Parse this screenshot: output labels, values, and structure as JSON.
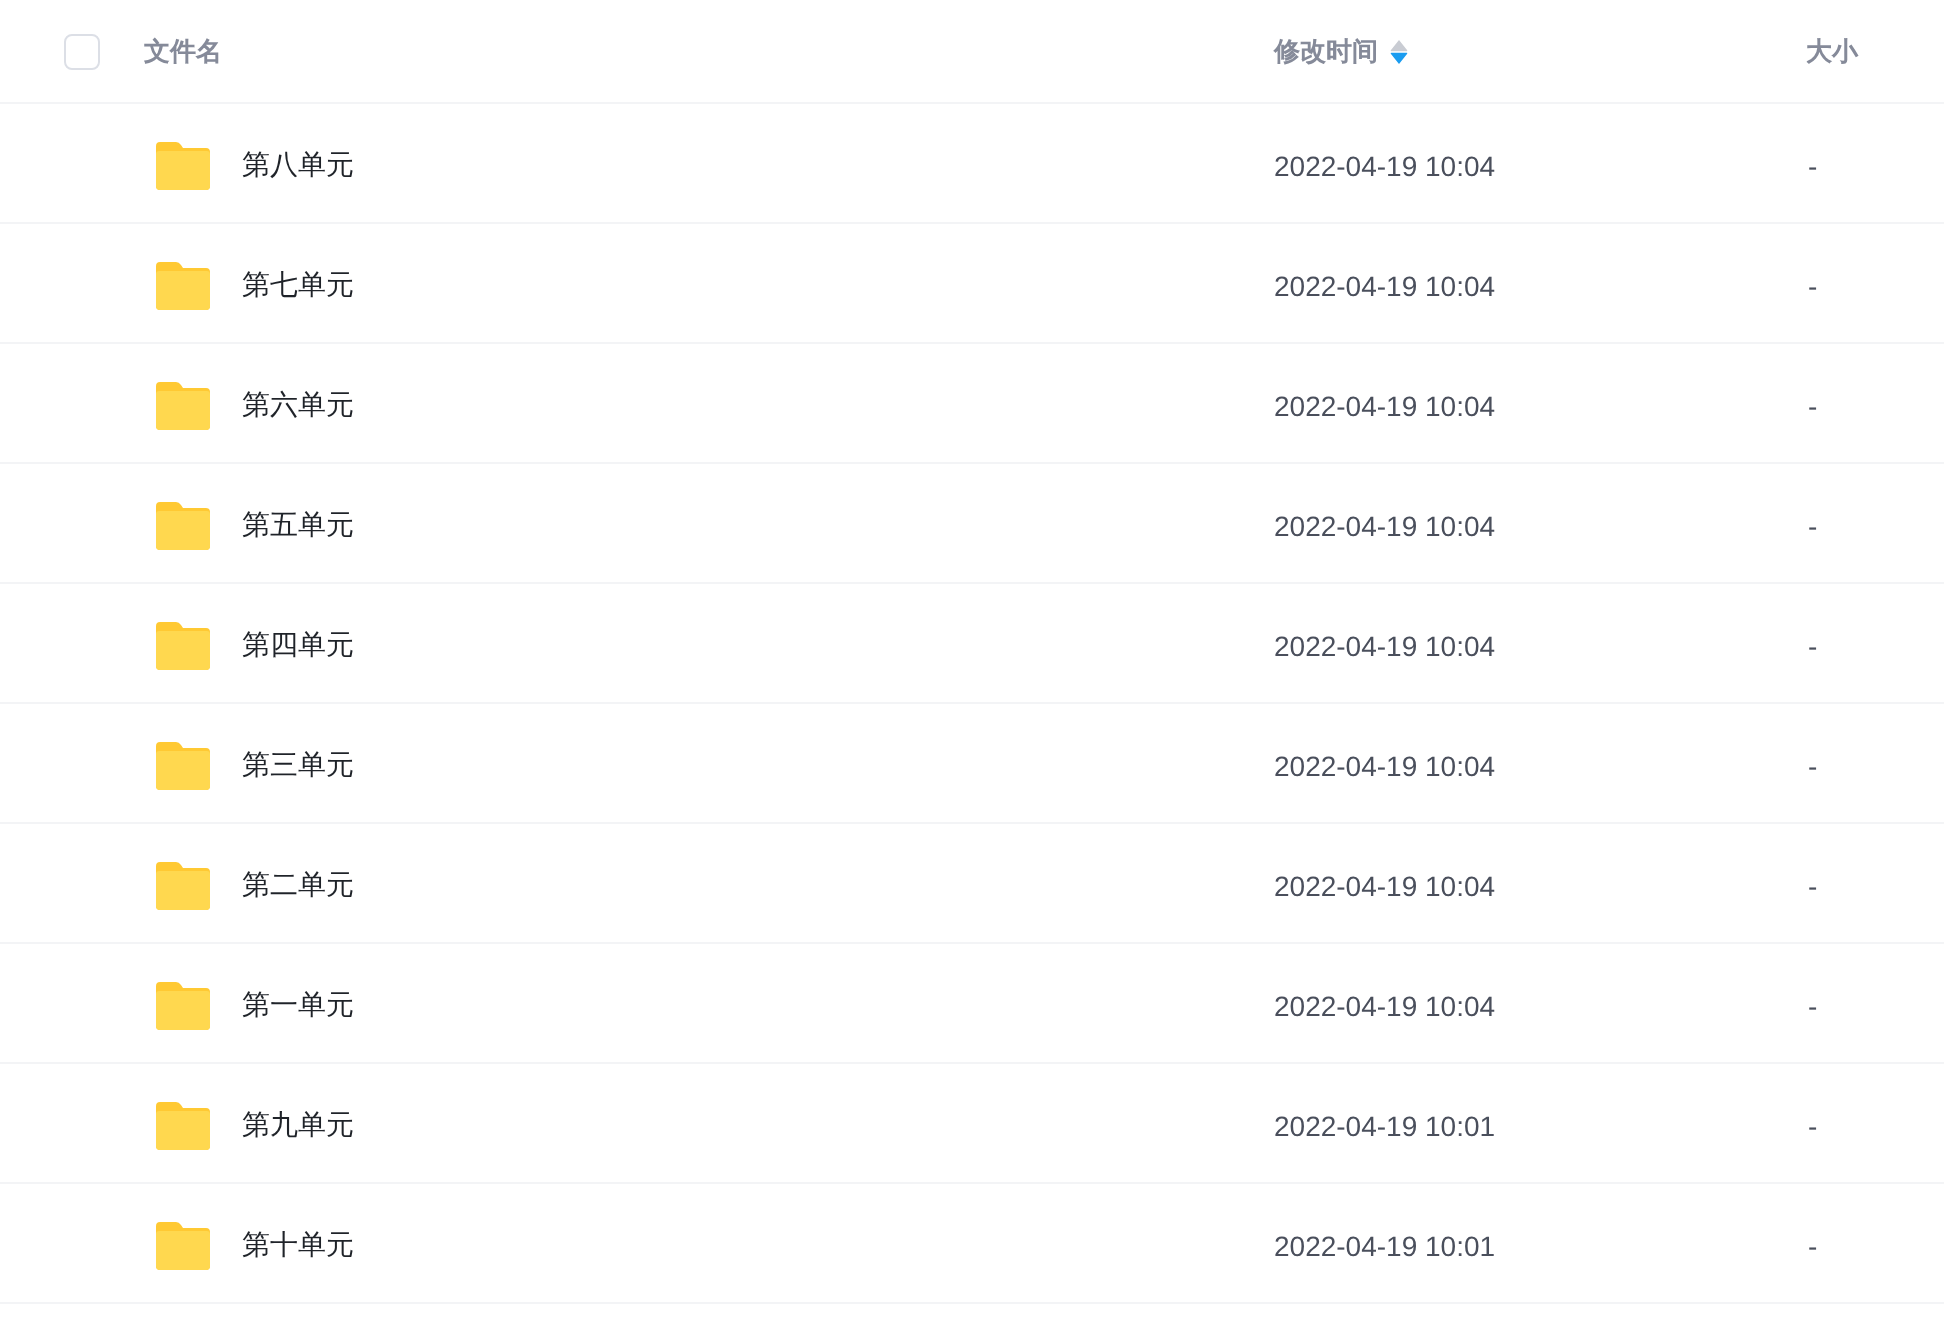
{
  "table": {
    "select_all": {
      "checked": false
    },
    "columns": [
      {
        "label": "文件名"
      },
      {
        "label": "修改时间",
        "sort_descending": true
      },
      {
        "label": "大小"
      }
    ],
    "rows": [
      {
        "kind": "folder",
        "name": "第八单元",
        "modified": "2022-04-19 10:04",
        "size": "-"
      },
      {
        "kind": "folder",
        "name": "第七单元",
        "modified": "2022-04-19 10:04",
        "size": "-"
      },
      {
        "kind": "folder",
        "name": "第六单元",
        "modified": "2022-04-19 10:04",
        "size": "-"
      },
      {
        "kind": "folder",
        "name": "第五单元",
        "modified": "2022-04-19 10:04",
        "size": "-"
      },
      {
        "kind": "folder",
        "name": "第四单元",
        "modified": "2022-04-19 10:04",
        "size": "-"
      },
      {
        "kind": "folder",
        "name": "第三单元",
        "modified": "2022-04-19 10:04",
        "size": "-"
      },
      {
        "kind": "folder",
        "name": "第二单元",
        "modified": "2022-04-19 10:04",
        "size": "-"
      },
      {
        "kind": "folder",
        "name": "第一单元",
        "modified": "2022-04-19 10:04",
        "size": "-"
      },
      {
        "kind": "folder",
        "name": "第九单元",
        "modified": "2022-04-19 10:01",
        "size": "-"
      },
      {
        "kind": "folder",
        "name": "第十单元",
        "modified": "2022-04-19 10:01",
        "size": "-"
      }
    ]
  }
}
